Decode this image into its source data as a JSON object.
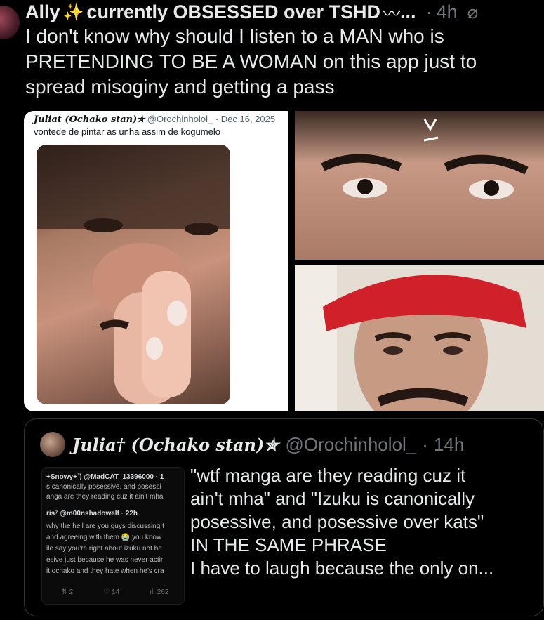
{
  "post": {
    "author_name": "Ally",
    "author_suffix": "currently OBSESSED over TSHD",
    "ellipsis": "...",
    "time": "4h",
    "text": "I don't know why should I listen to a MAN who is PRETENDING TO BE A WOMAN on this app just to spread misoginy and getting a pass"
  },
  "media": {
    "screenshot": {
      "name": "Juliat (Ochako stan)✮",
      "handle": "@Orochinholol_",
      "date": "· Dec 16, 2025",
      "text": "vontede de pintar as unha assim de kogumelo"
    }
  },
  "quote": {
    "name": "Julia† (Ochako stan)✮",
    "handle": "@Orochinholol_",
    "time": "14h",
    "text_lines": [
      "\"wtf manga are they reading cuz it",
      "ain't mha\" and \"Izuku is canonically",
      "posessive, and posessive over kats\"",
      "IN THE SAME PHRASE",
      "I have to laugh because the only on..."
    ],
    "thumb": {
      "lines": [
        "+Snowy+˙) @MadCAT_13396000 · 1",
        "s canonically posessive, and posessi",
        "anga are they reading cuz it ain't mha",
        "ris⁷ @m00nshadowelf · 22h",
        "why the hell are you guys discussing t",
        " and agreeing with them 😭 you know",
        "ile say you're right about izuku not be",
        "esive just because he was never actir",
        "it ochako and they hate when he's cra"
      ],
      "stats": [
        "2",
        "14",
        "262"
      ]
    }
  }
}
